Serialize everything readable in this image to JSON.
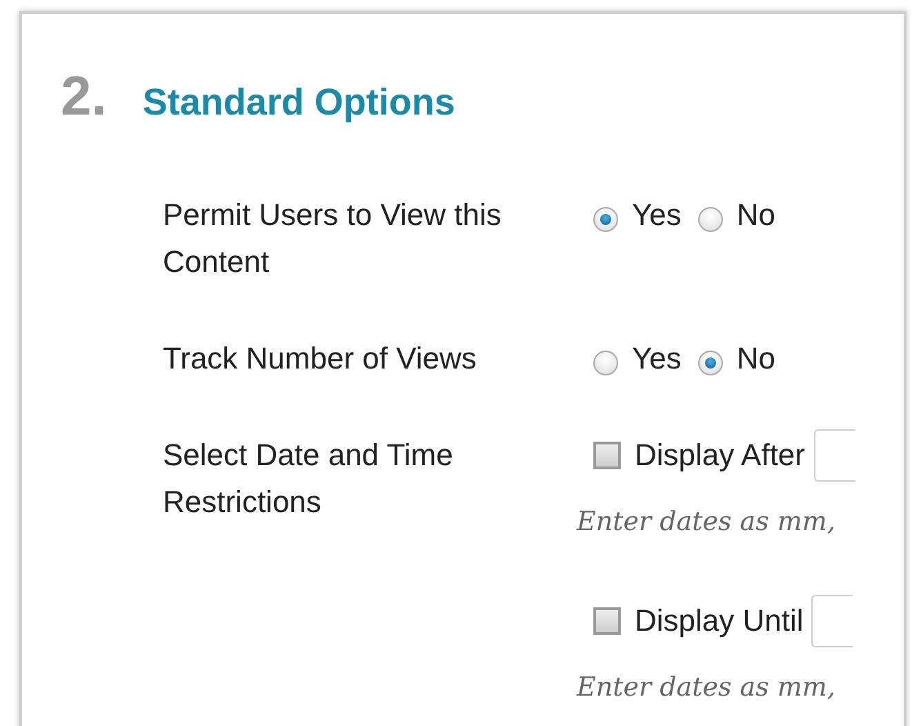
{
  "section": {
    "number": "2.",
    "title": "Standard Options"
  },
  "options": [
    {
      "kind": "radio",
      "label": "Permit Users to View this Content",
      "choices": [
        {
          "label": "Yes",
          "selected": true
        },
        {
          "label": "No",
          "selected": false
        }
      ]
    },
    {
      "kind": "radio",
      "label": "Track Number of Views",
      "choices": [
        {
          "label": "Yes",
          "selected": false
        },
        {
          "label": "No",
          "selected": true
        }
      ]
    },
    {
      "kind": "dates",
      "label": "Select Date and Time Restrictions",
      "restrictions": [
        {
          "label": "Display After",
          "checked": false,
          "hint": "Enter dates as mm,"
        },
        {
          "label": "Display Until",
          "checked": false,
          "hint": "Enter dates as mm,"
        }
      ]
    }
  ]
}
